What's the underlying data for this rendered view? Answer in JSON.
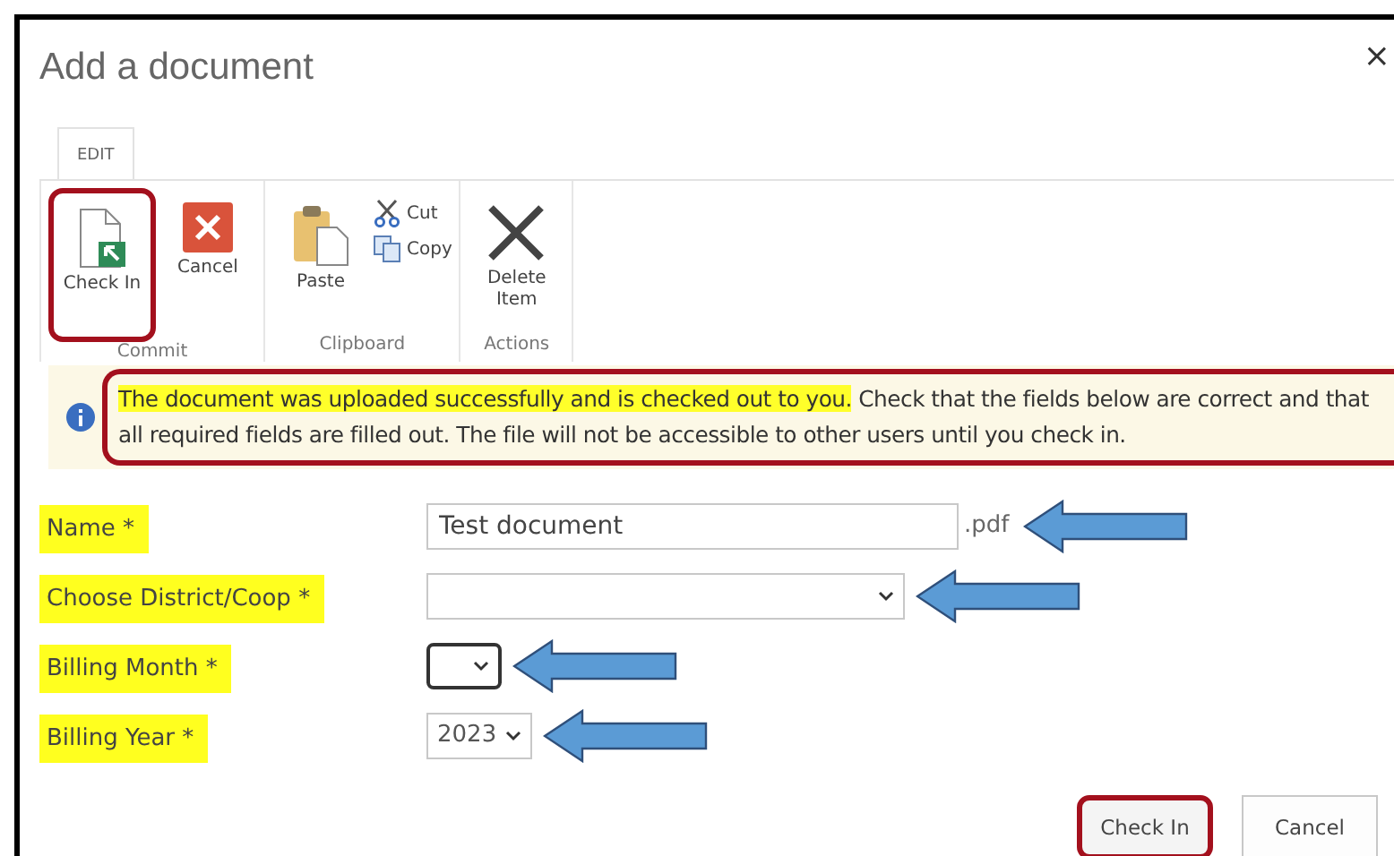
{
  "dialog": {
    "title": "Add a document",
    "close": "×"
  },
  "ribbon": {
    "tabs": [
      {
        "label": "EDIT",
        "selected": true
      }
    ],
    "groups": [
      {
        "label": "Commit",
        "buttons": [
          {
            "kind": "checkin",
            "label": "Check In",
            "outlined": true
          },
          {
            "kind": "cancel",
            "label": "Cancel",
            "outlined": false
          }
        ]
      },
      {
        "label": "Clipboard",
        "buttons": [
          {
            "kind": "paste",
            "label": "Paste",
            "outlined": false
          },
          {
            "kind": "cut",
            "label": "Cut",
            "outlined": false
          },
          {
            "kind": "copy",
            "label": "Copy",
            "outlined": false
          }
        ]
      },
      {
        "label": "Actions",
        "buttons": [
          {
            "kind": "delete",
            "label": "Delete Item",
            "outlined": false
          }
        ]
      }
    ]
  },
  "message": {
    "highlight": "The document was uploaded successfully and is checked out to you.",
    "text": "Check that the fields below are correct and that all required fields are filled out. The file will not be accessible to other users until you check in.",
    "outlined": true
  },
  "fields": [
    {
      "kind": "text",
      "label": "Name *",
      "value": "Test document",
      "suffix": ".pdf",
      "highlighted": true,
      "arrow": true,
      "focused": false
    },
    {
      "kind": "select",
      "label": "Choose District/Coop *",
      "highlighted": true,
      "arrow": true,
      "focused": false
    },
    {
      "kind": "select",
      "label": "Billing Month *",
      "highlighted": true,
      "arrow": true,
      "focused": true
    },
    {
      "kind": "select",
      "label": "Billing Year *",
      "value": "2023",
      "highlighted": true,
      "arrow": true,
      "focused": false
    }
  ],
  "buttons": [
    {
      "label": "Check In",
      "outlined": true
    },
    {
      "label": "Cancel",
      "outlined": false
    }
  ]
}
